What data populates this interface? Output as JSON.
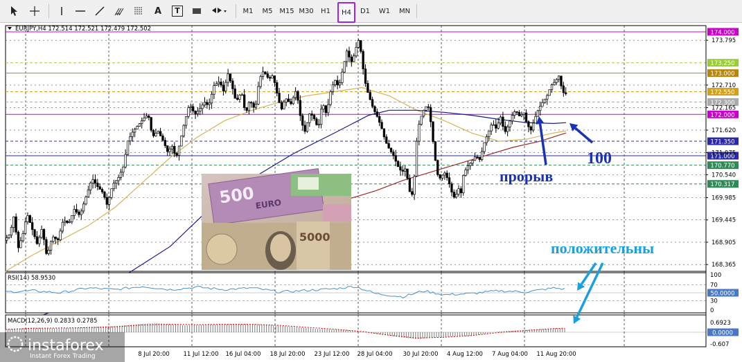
{
  "toolbar": {
    "timeframes": [
      "M1",
      "M5",
      "M15",
      "M30",
      "H1",
      "H4",
      "D1",
      "W1",
      "MN"
    ],
    "active_timeframe": "H4",
    "tools": [
      "cursor-icon",
      "crosshair-icon",
      "vertical-line-icon",
      "horizontal-line-icon",
      "trendline-icon",
      "andrews-pitchfork-icon",
      "fibonacci-icon",
      "text-icon",
      "text-label-icon",
      "rectangle-icon",
      "arrows-dropdown-icon"
    ],
    "text_tool_label": "A",
    "label_tool_label": "T"
  },
  "chart_data": {
    "type": "candlestick",
    "symbol_line": "EURJPY,H4  172.514 172.521 172.479 172.502",
    "price_ticks": [
      "173.795",
      "172.710",
      "172.165",
      "171.620",
      "171.075",
      "170.540",
      "169.985",
      "169.445",
      "168.905",
      "168.365"
    ],
    "time_labels": [
      "8 Jul 20:00",
      "11 Jul 12:00",
      "16 Jul 04:00",
      "18 Jul 20:00",
      "23 Jul 12:00",
      "28 Jul 04:00",
      "30 Jul 20:00",
      "4 Aug 12:00",
      "7 Aug 04:00",
      "11 Aug 20:00"
    ],
    "ylim": [
      168.2,
      174.15
    ],
    "price_path": [
      [
        0,
        168.95
      ],
      [
        8,
        169.1
      ],
      [
        14,
        169.55
      ],
      [
        20,
        168.75
      ],
      [
        27,
        169.1
      ],
      [
        33,
        169.6
      ],
      [
        40,
        169.25
      ],
      [
        48,
        168.85
      ],
      [
        55,
        169.25
      ],
      [
        62,
        168.55
      ],
      [
        70,
        169.05
      ],
      [
        78,
        168.95
      ],
      [
        86,
        169.45
      ],
      [
        94,
        169.35
      ],
      [
        102,
        169.7
      ],
      [
        110,
        169.55
      ],
      [
        120,
        170.05
      ],
      [
        128,
        170.45
      ],
      [
        136,
        170.25
      ],
      [
        144,
        170.1
      ],
      [
        150,
        169.8
      ],
      [
        158,
        170.3
      ],
      [
        166,
        170.45
      ],
      [
        174,
        170.75
      ],
      [
        180,
        171.35
      ],
      [
        188,
        171.6
      ],
      [
        196,
        171.75
      ],
      [
        203,
        171.9
      ],
      [
        210,
        172.0
      ],
      [
        216,
        171.45
      ],
      [
        224,
        171.6
      ],
      [
        232,
        171.35
      ],
      [
        238,
        171.1
      ],
      [
        246,
        171.25
      ],
      [
        250,
        170.9
      ],
      [
        256,
        171.3
      ],
      [
        262,
        171.75
      ],
      [
        270,
        172.25
      ],
      [
        278,
        172.0
      ],
      [
        286,
        172.15
      ],
      [
        292,
        172.3
      ],
      [
        298,
        172.2
      ],
      [
        306,
        172.7
      ],
      [
        314,
        172.8
      ],
      [
        320,
        172.55
      ],
      [
        326,
        173.0
      ],
      [
        332,
        172.7
      ],
      [
        338,
        172.3
      ],
      [
        346,
        172.55
      ],
      [
        352,
        172.0
      ],
      [
        358,
        172.35
      ],
      [
        366,
        172.1
      ],
      [
        372,
        172.85
      ],
      [
        378,
        173.05
      ],
      [
        386,
        172.85
      ],
      [
        392,
        172.95
      ],
      [
        398,
        172.5
      ],
      [
        404,
        172.1
      ],
      [
        410,
        172.4
      ],
      [
        418,
        172.25
      ],
      [
        426,
        172.6
      ],
      [
        432,
        171.95
      ],
      [
        438,
        171.55
      ],
      [
        446,
        172.05
      ],
      [
        452,
        171.9
      ],
      [
        458,
        171.65
      ],
      [
        464,
        172.3
      ],
      [
        470,
        172.0
      ],
      [
        476,
        172.55
      ],
      [
        482,
        172.85
      ],
      [
        488,
        172.65
      ],
      [
        494,
        173.1
      ],
      [
        500,
        173.55
      ],
      [
        506,
        173.25
      ],
      [
        512,
        173.5
      ],
      [
        516,
        173.85
      ],
      [
        520,
        173.55
      ],
      [
        524,
        173.05
      ],
      [
        528,
        172.65
      ],
      [
        532,
        172.45
      ],
      [
        538,
        172.15
      ],
      [
        544,
        171.95
      ],
      [
        550,
        171.7
      ],
      [
        556,
        171.35
      ],
      [
        562,
        171.15
      ],
      [
        568,
        171.0
      ],
      [
        574,
        170.75
      ],
      [
        580,
        170.6
      ],
      [
        586,
        170.7
      ],
      [
        590,
        170.25
      ],
      [
        594,
        169.95
      ],
      [
        598,
        170.4
      ],
      [
        602,
        171.4
      ],
      [
        606,
        171.85
      ],
      [
        612,
        172.1
      ],
      [
        618,
        172.25
      ],
      [
        622,
        171.85
      ],
      [
        628,
        171.0
      ],
      [
        632,
        170.55
      ],
      [
        636,
        170.45
      ],
      [
        642,
        170.6
      ],
      [
        648,
        170.4
      ],
      [
        654,
        170.05
      ],
      [
        658,
        169.95
      ],
      [
        662,
        170.25
      ],
      [
        666,
        170.05
      ],
      [
        670,
        170.55
      ],
      [
        676,
        170.75
      ],
      [
        682,
        170.85
      ],
      [
        688,
        171.0
      ],
      [
        694,
        170.9
      ],
      [
        700,
        171.3
      ],
      [
        706,
        171.55
      ],
      [
        712,
        171.8
      ],
      [
        718,
        171.65
      ],
      [
        724,
        171.95
      ],
      [
        730,
        171.55
      ],
      [
        736,
        171.75
      ],
      [
        740,
        171.95
      ],
      [
        746,
        172.1
      ],
      [
        752,
        171.95
      ],
      [
        758,
        172.05
      ],
      [
        762,
        171.8
      ],
      [
        768,
        171.6
      ],
      [
        774,
        171.9
      ],
      [
        780,
        172.15
      ],
      [
        786,
        172.3
      ],
      [
        792,
        172.45
      ],
      [
        798,
        172.7
      ],
      [
        804,
        172.8
      ],
      [
        810,
        172.95
      ],
      [
        814,
        172.55
      ],
      [
        818,
        172.5
      ]
    ],
    "ma_yellow": [
      [
        0,
        168.2
      ],
      [
        40,
        168.6
      ],
      [
        80,
        168.95
      ],
      [
        120,
        169.3
      ],
      [
        160,
        169.75
      ],
      [
        200,
        170.35
      ],
      [
        240,
        170.95
      ],
      [
        280,
        171.45
      ],
      [
        320,
        171.85
      ],
      [
        360,
        172.1
      ],
      [
        400,
        172.3
      ],
      [
        440,
        172.45
      ],
      [
        480,
        172.55
      ],
      [
        520,
        172.65
      ],
      [
        560,
        172.45
      ],
      [
        600,
        172.1
      ],
      [
        640,
        171.85
      ],
      [
        680,
        171.55
      ],
      [
        720,
        171.35
      ],
      [
        760,
        171.4
      ],
      [
        800,
        171.55
      ],
      [
        818,
        171.6
      ]
    ],
    "ma_blue": [
      [
        0,
        166.8
      ],
      [
        80,
        167.3
      ],
      [
        160,
        167.95
      ],
      [
        240,
        168.8
      ],
      [
        300,
        169.75
      ],
      [
        360,
        170.45
      ],
      [
        420,
        171.05
      ],
      [
        480,
        171.55
      ],
      [
        530,
        171.98
      ],
      [
        560,
        172.1
      ],
      [
        600,
        172.1
      ],
      [
        640,
        172.05
      ],
      [
        680,
        171.98
      ],
      [
        720,
        171.88
      ],
      [
        760,
        171.8
      ],
      [
        800,
        171.78
      ],
      [
        818,
        171.8
      ]
    ],
    "ma_red": [
      [
        500,
        169.95
      ],
      [
        540,
        170.15
      ],
      [
        580,
        170.4
      ],
      [
        620,
        170.6
      ],
      [
        660,
        170.8
      ],
      [
        700,
        171.0
      ],
      [
        740,
        171.2
      ],
      [
        780,
        171.35
      ],
      [
        818,
        171.55
      ]
    ],
    "levels": [
      {
        "price": "174.000",
        "color": "#cc00cc",
        "style": "solid",
        "label": "174.000"
      },
      {
        "price": "173.250",
        "color": "#9acd32",
        "style": "dash",
        "label": "173.250"
      },
      {
        "price": "173.000",
        "color": "#b8860b",
        "style": "solid",
        "label": "173.000"
      },
      {
        "price": "172.550",
        "color": "#d4a017",
        "style": "dash",
        "label": "172.550"
      },
      {
        "price": "172.300",
        "color": "#aaaaaa",
        "style": "dash",
        "label": "172.300"
      },
      {
        "price": "172.000",
        "color": "#cc00cc",
        "style": "solid",
        "label": "172.000"
      },
      {
        "price": "171.350",
        "color": "#2a2aa8",
        "style": "dash",
        "label": "171.350"
      },
      {
        "price": "171.000",
        "color": "#2a2aa8",
        "style": "solid",
        "label": "171.000"
      },
      {
        "price": "170.770",
        "color": "#2e8b57",
        "style": "dash",
        "label": "170.770"
      },
      {
        "price": "170.317",
        "color": "#2e8b57",
        "style": "dash",
        "label": "170.317"
      }
    ],
    "rsi": {
      "label": "RSI(14) 58.9530",
      "levels": [
        "100",
        "70",
        "50.0000",
        "30",
        "0"
      ],
      "values": [
        [
          0,
          52
        ],
        [
          40,
          55
        ],
        [
          80,
          50
        ],
        [
          120,
          62
        ],
        [
          160,
          58
        ],
        [
          200,
          66
        ],
        [
          240,
          58
        ],
        [
          280,
          64
        ],
        [
          320,
          58
        ],
        [
          360,
          62
        ],
        [
          400,
          52
        ],
        [
          440,
          56
        ],
        [
          480,
          60
        ],
        [
          510,
          66
        ],
        [
          540,
          48
        ],
        [
          580,
          40
        ],
        [
          610,
          55
        ],
        [
          640,
          45
        ],
        [
          680,
          48
        ],
        [
          720,
          55
        ],
        [
          760,
          52
        ],
        [
          800,
          62
        ],
        [
          818,
          59
        ]
      ]
    },
    "macd": {
      "label": "MACD(12,26,9) 0.2833 0.2785",
      "levels": [
        "0.6923",
        "0.0000",
        "-0.607"
      ],
      "hist": [
        [
          0,
          0.2
        ],
        [
          40,
          0.3
        ],
        [
          80,
          0.25
        ],
        [
          120,
          0.35
        ],
        [
          160,
          0.4
        ],
        [
          200,
          0.55
        ],
        [
          220,
          0.6
        ],
        [
          260,
          0.45
        ],
        [
          300,
          0.5
        ],
        [
          340,
          0.55
        ],
        [
          380,
          0.5
        ],
        [
          420,
          0.35
        ],
        [
          460,
          0.2
        ],
        [
          500,
          0.15
        ],
        [
          540,
          -0.1
        ],
        [
          580,
          -0.35
        ],
        [
          600,
          -0.45
        ],
        [
          640,
          -0.3
        ],
        [
          680,
          -0.25
        ],
        [
          720,
          0.05
        ],
        [
          760,
          0.15
        ],
        [
          800,
          0.25
        ],
        [
          818,
          0.28
        ]
      ],
      "signal": [
        [
          0,
          0.18
        ],
        [
          40,
          0.26
        ],
        [
          80,
          0.28
        ],
        [
          120,
          0.3
        ],
        [
          160,
          0.36
        ],
        [
          200,
          0.48
        ],
        [
          240,
          0.52
        ],
        [
          280,
          0.5
        ],
        [
          320,
          0.52
        ],
        [
          360,
          0.52
        ],
        [
          400,
          0.45
        ],
        [
          440,
          0.32
        ],
        [
          480,
          0.2
        ],
        [
          520,
          0.05
        ],
        [
          560,
          -0.2
        ],
        [
          600,
          -0.38
        ],
        [
          640,
          -0.33
        ],
        [
          680,
          -0.22
        ],
        [
          720,
          -0.02
        ],
        [
          760,
          0.12
        ],
        [
          800,
          0.24
        ],
        [
          818,
          0.27
        ]
      ]
    }
  },
  "annotations": {
    "breakout": "прорыв",
    "ma_period": "100",
    "positive": "положительны"
  },
  "watermark": {
    "brand": "instaforex",
    "tagline": "Instant Forex Trading"
  },
  "colors": {
    "candle": "#000000",
    "ma_yellow": "#d8b45a",
    "ma_blue": "#1a1a8c",
    "ma_red": "#a02828",
    "rsi_line": "#4a90c8",
    "macd_hist": "#8b0000",
    "annotation_blue": "#1a32b4",
    "annotation_cyan": "#1aa0dc",
    "toolbar_active": "#a020f0"
  }
}
